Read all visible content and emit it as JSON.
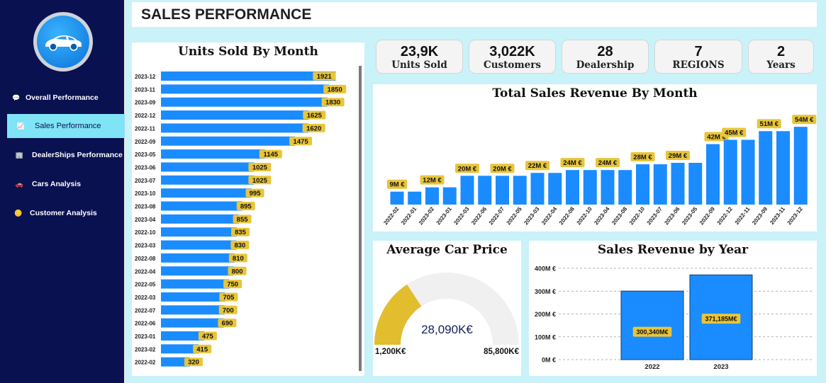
{
  "header": {
    "title": "SALES PERFORMANCE"
  },
  "sidebar": {
    "logo_icon": "car-icon",
    "items": [
      {
        "label": "Overall Performance",
        "icon": "speech-bubble-icon",
        "active": false
      },
      {
        "label": "Sales Performance",
        "icon": "chart-icon",
        "active": true
      },
      {
        "label": "DealerShips Performance",
        "icon": "building-icon",
        "active": false
      },
      {
        "label": "Cars Analysis",
        "icon": "car-small-icon",
        "active": false
      },
      {
        "label": "Customer Analysis",
        "icon": "coin-icon",
        "active": false
      }
    ]
  },
  "kpis": [
    {
      "value": "23,9K",
      "label": "Units Sold"
    },
    {
      "value": "3,022K",
      "label": "Customers"
    },
    {
      "value": "28",
      "label": "Dealership"
    },
    {
      "value": "7",
      "label": "REGIONS"
    },
    {
      "value": "2",
      "label": "Years"
    }
  ],
  "colors": {
    "bar": "#1a8cff",
    "label_bg": "#e8c53a",
    "gauge_fill": "#e2bd2e",
    "gauge_track": "#f0f0f0",
    "sidebar": "#0a1150",
    "background": "#c9f2f9"
  },
  "units_by_month": {
    "title": "Units Sold By Month"
  },
  "revenue_by_month": {
    "title": "Total Sales Revenue By Month"
  },
  "average_price": {
    "title": "Average Car Price",
    "value": "28,090K€",
    "min_label": "1,200K€",
    "max_label": "85,800K€",
    "fill_fraction": 0.315
  },
  "revenue_by_year": {
    "title": "Sales Revenue by Year"
  },
  "chart_data": [
    {
      "type": "bar",
      "orientation": "horizontal",
      "title": "Units Sold By Month",
      "categories": [
        "2023-12",
        "2023-11",
        "2023-09",
        "2022-12",
        "2022-11",
        "2022-09",
        "2023-05",
        "2023-06",
        "2023-07",
        "2023-10",
        "2023-08",
        "2023-04",
        "2022-10",
        "2023-03",
        "2022-08",
        "2022-04",
        "2022-05",
        "2022-03",
        "2022-07",
        "2022-06",
        "2023-01",
        "2023-02",
        "2022-02"
      ],
      "values": [
        1921,
        1850,
        1830,
        1625,
        1620,
        1475,
        1145,
        1025,
        1025,
        995,
        895,
        855,
        835,
        830,
        810,
        800,
        750,
        705,
        700,
        690,
        475,
        415,
        320
      ],
      "xlim": [
        0,
        1950
      ]
    },
    {
      "type": "bar",
      "title": "Total Sales Revenue By Month",
      "categories": [
        "2022-02",
        "2022-01",
        "2023-02",
        "2023-01",
        "2022-03",
        "2022-06",
        "2022-07",
        "2022-05",
        "2023-03",
        "2022-04",
        "2022-08",
        "2022-10",
        "2023-04",
        "2023-08",
        "2022-10",
        "2023-07",
        "2023-06",
        "2023-05",
        "2022-09",
        "2022-12",
        "2022-11",
        "2023-09",
        "2023-11",
        "2023-12"
      ],
      "values": [
        9,
        9,
        12,
        12,
        20,
        20,
        20,
        20,
        22,
        22,
        24,
        24,
        24,
        24,
        28,
        28,
        29,
        29,
        42,
        45,
        45,
        51,
        51,
        54
      ],
      "data_labels": [
        "9M €",
        "",
        "12M €",
        "",
        "20M €",
        "",
        "20M €",
        "",
        "22M €",
        "",
        "24M €",
        "",
        "24M €",
        "",
        "28M €",
        "",
        "29M €",
        "",
        "42M €",
        "45M €",
        "",
        "51M €",
        "",
        "54M €"
      ],
      "ylim": [
        0,
        58
      ]
    },
    {
      "type": "bar",
      "title": "Sales Revenue by Year",
      "categories": [
        "2023",
        "2022"
      ],
      "values": [
        371.185,
        300.34
      ],
      "data_labels": [
        "371,185M€",
        "300,340M€"
      ],
      "y_ticks": [
        "400M €",
        "300M €",
        "200M €",
        "100M €",
        "0M €"
      ],
      "ylim": [
        0,
        400
      ],
      "grid": true
    }
  ]
}
